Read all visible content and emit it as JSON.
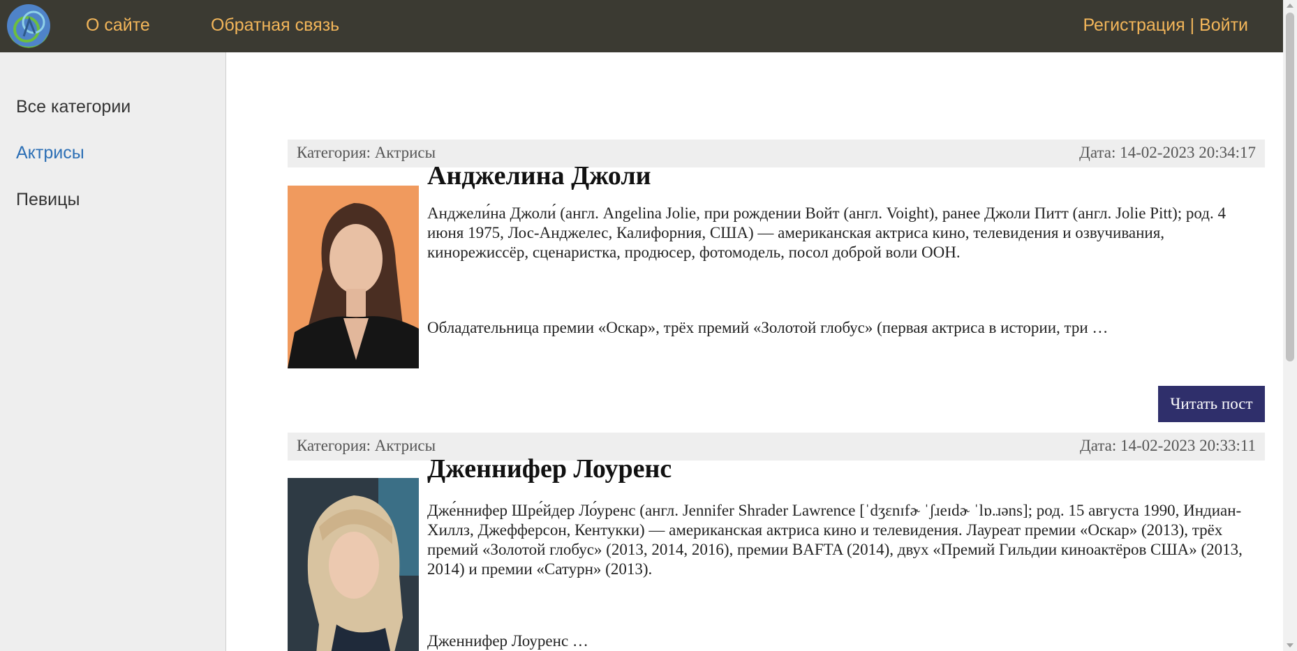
{
  "header": {
    "nav": [
      {
        "label": "О сайте"
      },
      {
        "label": "Обратная связь"
      }
    ],
    "auth": {
      "register": "Регистрация",
      "separator": " | ",
      "login": "Войти"
    }
  },
  "sidebar": {
    "items": [
      {
        "label": "Все категории",
        "active": false
      },
      {
        "label": "Актрисы",
        "active": true
      },
      {
        "label": "Певицы",
        "active": false
      }
    ]
  },
  "posts": [
    {
      "category": "Категория: Актрисы",
      "date": "Дата: 14-02-2023 20:34:17",
      "title": "Анджелина Джоли",
      "paragraph1": "Анджели́на Джоли́ (англ. Angelina Jolie, при рождении Войт (англ. Voight), ранее Джоли Питт (англ. Jolie Pitt); род. 4 июня 1975, Лос-Анджелес, Калифорния, США) — американская актриса кино, телевидения и озвучивания, кинорежиссёр, сценаристка, продюсер, фотомодель, посол доброй воли ООН.",
      "paragraph2": "Обладательница премии «Оскар», трёх премий «Золотой глобус» (первая актриса в истории, три …",
      "button": "Читать пост"
    },
    {
      "category": "Категория: Актрисы",
      "date": "Дата: 14-02-2023 20:33:11",
      "title": "Дженнифер Лоуренс",
      "paragraph1": "Дже́ннифер Шре́йдер Ло́уренс (англ. Jennifer Shrader Lawrence [ˈdʒɛnɪfɚ ˈʃɹeɪdɚ ˈlɒ.ɹəns]; род. 15 августа 1990, Индиан-Хиллз, Джефферсон, Кентукки) — американская актриса кино и телевидения. Лауреат премии «Оскар» (2013), трёх премий «Золотой глобус» (2013, 2014, 2016), премии BAFTA (2014), двух «Премий Гильдии киноактёров США» (2013, 2014) и премии «Сатурн» (2013).",
      "paragraph2": "Дженнифер Лоуренс …"
    }
  ],
  "colors": {
    "header_bg": "#3b3a32",
    "nav_link": "#f3b65a",
    "sidebar_bg": "#eeeeee",
    "sidebar_active": "#2c6fb5",
    "button_bg": "#2f2f6b"
  }
}
